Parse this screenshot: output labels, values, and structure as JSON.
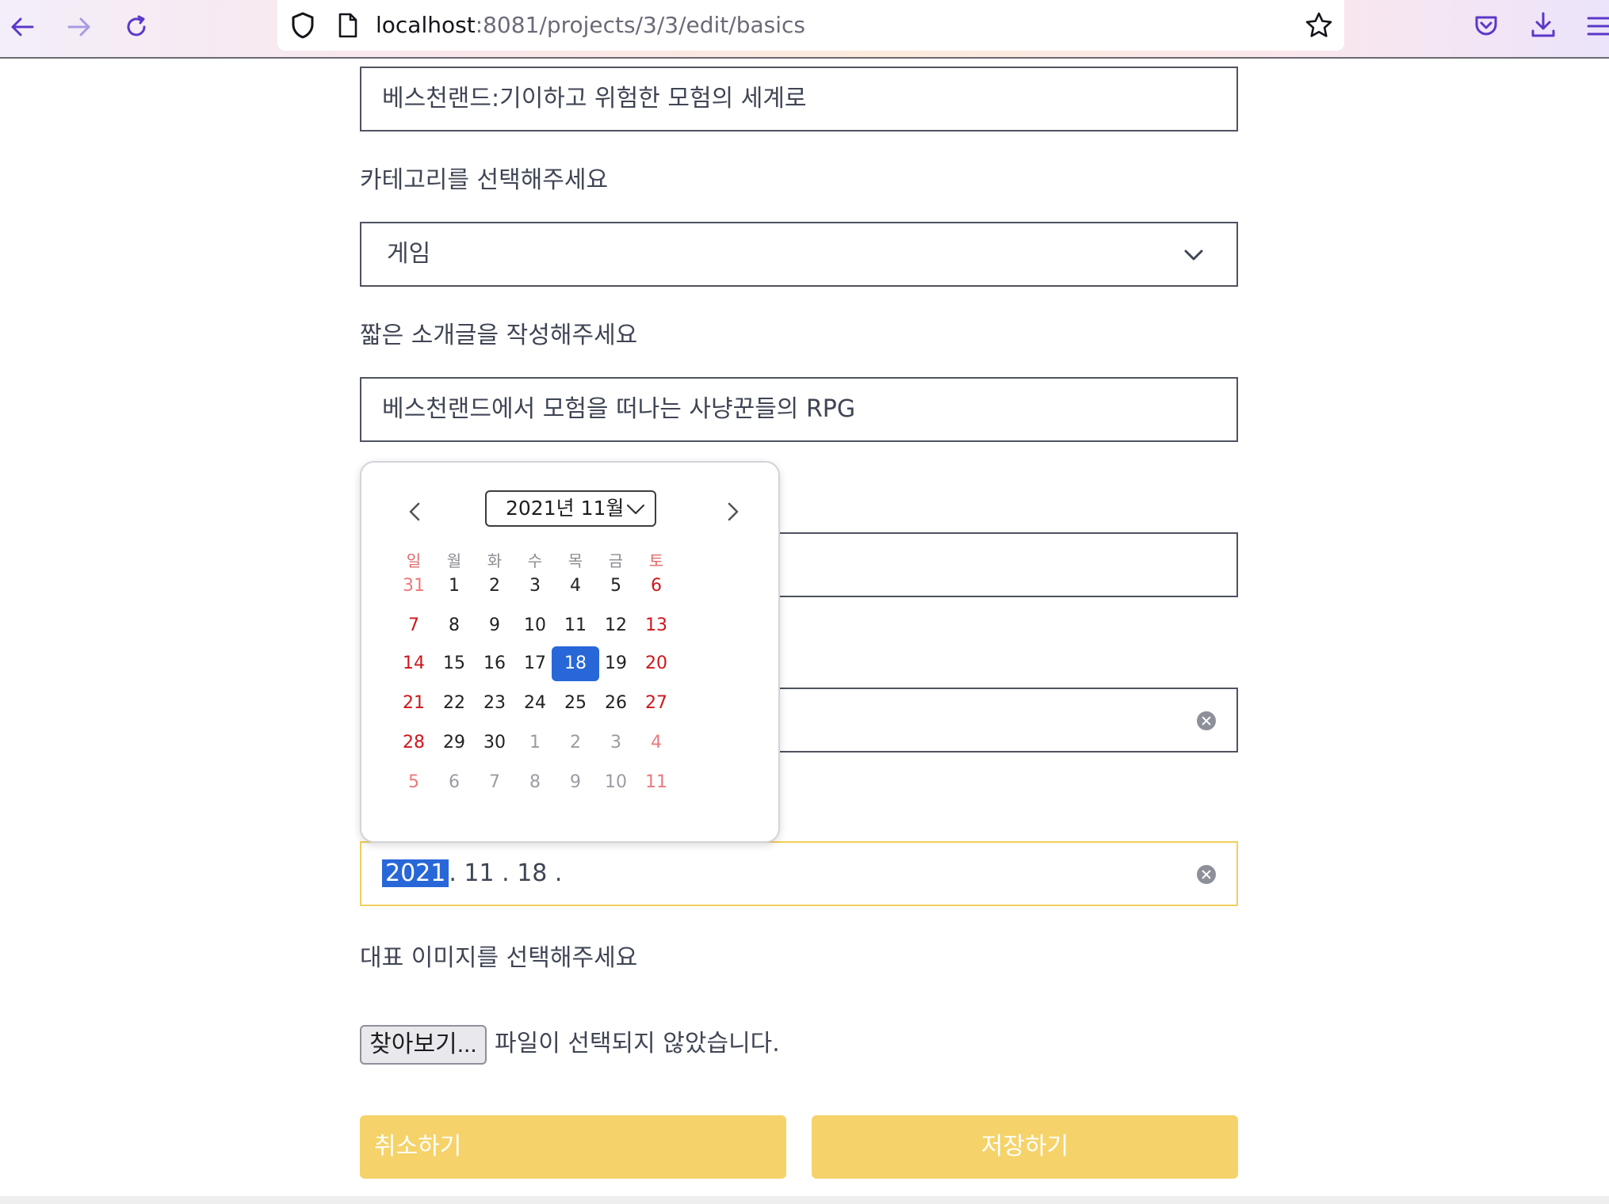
{
  "browser": {
    "url_host": "localhost",
    "url_path": ":8081/projects/3/3/edit/basics"
  },
  "form": {
    "title_value": "베스천랜드:기이하고 위험한 모험의 세계로",
    "category_label": "카테고리를 선택해주세요",
    "category_value": "게임",
    "intro_label": "짧은 소개글을 작성해주세요",
    "intro_value": "베스천랜드에서 모험을 떠나는 사냥꾼들의 RPG",
    "date_year": "2021",
    "date_rest": ". 11 . 18 .",
    "image_label": "대표 이미지를 선택해주세요",
    "file_button": "찾아보기...",
    "file_status": "파일이 선택되지 않았습니다.",
    "cancel_button": "취소하기",
    "save_button": "저장하기"
  },
  "calendar": {
    "month_label": "2021년 11월",
    "weekdays": [
      "일",
      "월",
      "화",
      "수",
      "목",
      "금",
      "토"
    ],
    "weeks": [
      [
        "31",
        "1",
        "2",
        "3",
        "4",
        "5",
        "6"
      ],
      [
        "7",
        "8",
        "9",
        "10",
        "11",
        "12",
        "13"
      ],
      [
        "14",
        "15",
        "16",
        "17",
        "18",
        "19",
        "20"
      ],
      [
        "21",
        "22",
        "23",
        "24",
        "25",
        "26",
        "27"
      ],
      [
        "28",
        "29",
        "30",
        "1",
        "2",
        "3",
        "4"
      ],
      [
        "5",
        "6",
        "7",
        "8",
        "9",
        "10",
        "11"
      ]
    ],
    "selected": "18"
  },
  "colors": {
    "accent_yellow": "#f5d36a",
    "selection_blue": "#2867d8",
    "weekend_red": "#d0161b"
  }
}
